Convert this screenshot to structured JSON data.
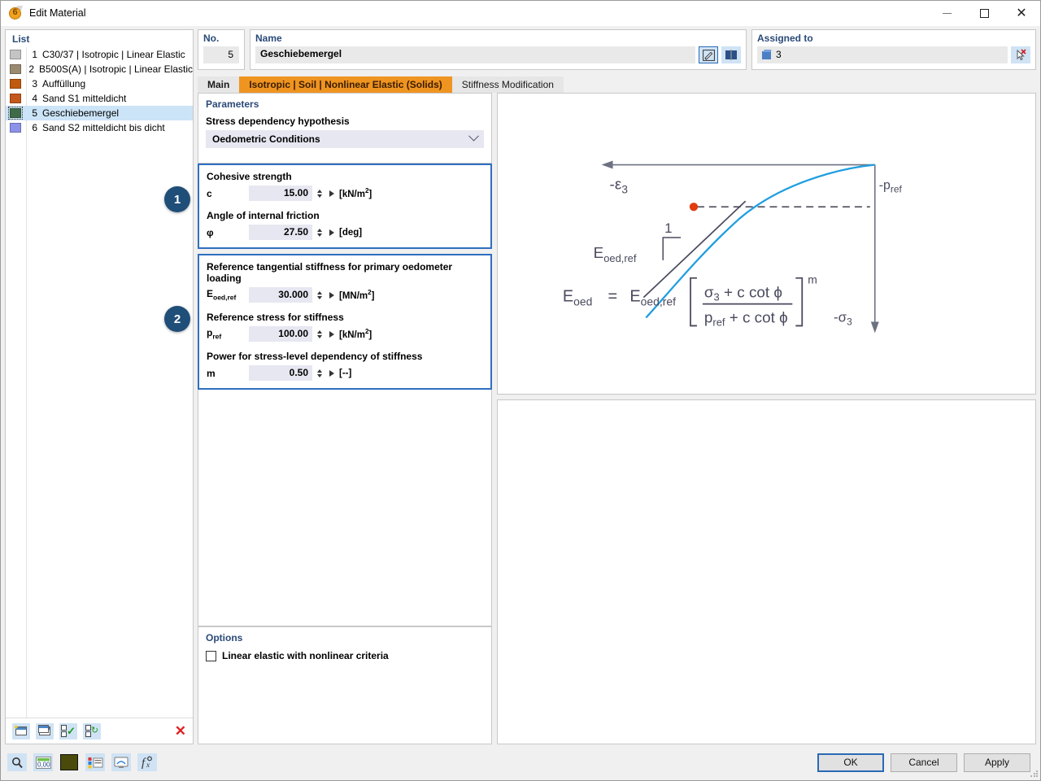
{
  "window": {
    "title": "Edit Material",
    "icon": "material-sphere-icon",
    "minimize": "–",
    "maximize": "□",
    "close": "✕"
  },
  "list_panel": {
    "legend": "List",
    "items": [
      {
        "num": "1",
        "label": "C30/37 | Isotropic | Linear Elastic",
        "color": "#c4c4c4",
        "selected": false
      },
      {
        "num": "2",
        "label": "B500S(A) | Isotropic | Linear Elastic",
        "color": "#9a8a70",
        "selected": false
      },
      {
        "num": "3",
        "label": "Auffüllung",
        "color": "#bf5a10",
        "selected": false
      },
      {
        "num": "4",
        "label": "Sand S1 mitteldicht",
        "color": "#c4581a",
        "selected": false
      },
      {
        "num": "5",
        "label": "Geschiebemergel",
        "color": "#3f6b48",
        "selected": true
      },
      {
        "num": "6",
        "label": "Sand S2 mitteldicht bis dicht",
        "color": "#8b92e8",
        "selected": false
      }
    ],
    "toolbar": {
      "new": "new-material-button",
      "duplicate": "duplicate-material-button",
      "check": "check-selection-button",
      "refresh": "refresh-selection-button",
      "delete": "✕"
    }
  },
  "header": {
    "no_legend": "No.",
    "no_value": "5",
    "name_legend": "Name",
    "name_value": "Geschiebemergel",
    "edit_button": "edit-name-icon",
    "library_button": "material-library-icon",
    "assigned_legend": "Assigned to",
    "assigned_value": "3",
    "assigned_pick_button": "pick-objects-icon"
  },
  "tabs": [
    {
      "label": "Main",
      "active": false
    },
    {
      "label": "Isotropic | Soil | Nonlinear Elastic (Solids)",
      "active": true
    },
    {
      "label": "Stiffness Modification",
      "active": false
    }
  ],
  "parameters": {
    "title": "Parameters",
    "hypothesis_label": "Stress dependency hypothesis",
    "hypothesis_value": "Oedometric Conditions",
    "hypothesis_chevron": "chevron-down-icon"
  },
  "group1": {
    "badge": "1",
    "fields": [
      {
        "label": "Cohesive strength",
        "symbol": "c",
        "symbol_sub": "",
        "value": "15.00",
        "unit": "[kN/m",
        "unit_sup": "2",
        "unit_tail": "]"
      },
      {
        "label": "Angle of internal friction",
        "symbol": "φ",
        "symbol_sub": "",
        "value": "27.50",
        "unit": "[deg]",
        "unit_sup": "",
        "unit_tail": ""
      }
    ]
  },
  "group2": {
    "badge": "2",
    "fields": [
      {
        "label": "Reference tangential stiffness for primary oedometer loading",
        "symbol": "E",
        "symbol_sub": "oed,ref",
        "value": "30.000",
        "unit": "[MN/m",
        "unit_sup": "2",
        "unit_tail": "]"
      },
      {
        "label": "Reference stress for stiffness",
        "symbol": "p",
        "symbol_sub": "ref",
        "value": "100.00",
        "unit": "[kN/m",
        "unit_sup": "2",
        "unit_tail": "]"
      },
      {
        "label": "Power for stress-level dependency of stiffness",
        "symbol": "m",
        "symbol_sub": "",
        "value": "0.50",
        "unit": "[--]",
        "unit_sup": "",
        "unit_tail": ""
      }
    ]
  },
  "options": {
    "title": "Options",
    "checkbox_label": "Linear elastic with nonlinear criteria",
    "checkbox_checked": false
  },
  "diagram": {
    "y_axis_label": "-ε",
    "y_axis_sub": "3",
    "x_axis_label": "-σ",
    "x_axis_sub": "3",
    "pref_label": "-p",
    "pref_sub": "ref",
    "slope_label": "E",
    "slope_sub": "oed,ref",
    "slope_one": "1",
    "curve_color": "#1f9ee0",
    "tangent_color": "#4a4a5e",
    "point_color": "#e03c10",
    "formula": {
      "lhs": "E",
      "lhs_sub": "oed",
      "eq": "=",
      "rhs": "E",
      "rhs_sub": "oed,ref",
      "num": "σ₃ + c cot ϕ",
      "den": "pᵣₑᶠ + c cot ϕ",
      "numerator_main": "σ",
      "numerator_sub": "3",
      "numerator_rest": " + c cot ϕ",
      "denominator_main": "p",
      "denominator_sub": "ref",
      "denominator_rest": " + c cot ϕ",
      "exponent": "m"
    }
  },
  "bottom_toolbar": {
    "icons": [
      "search-magnifier-icon",
      "numeric-format-icon",
      "color-swatch-icon",
      "legend-icon",
      "display-icon",
      "function-icon"
    ],
    "color_swatch": "#4a4a0a"
  },
  "dialog_buttons": {
    "ok": "OK",
    "cancel": "Cancel",
    "apply": "Apply"
  }
}
